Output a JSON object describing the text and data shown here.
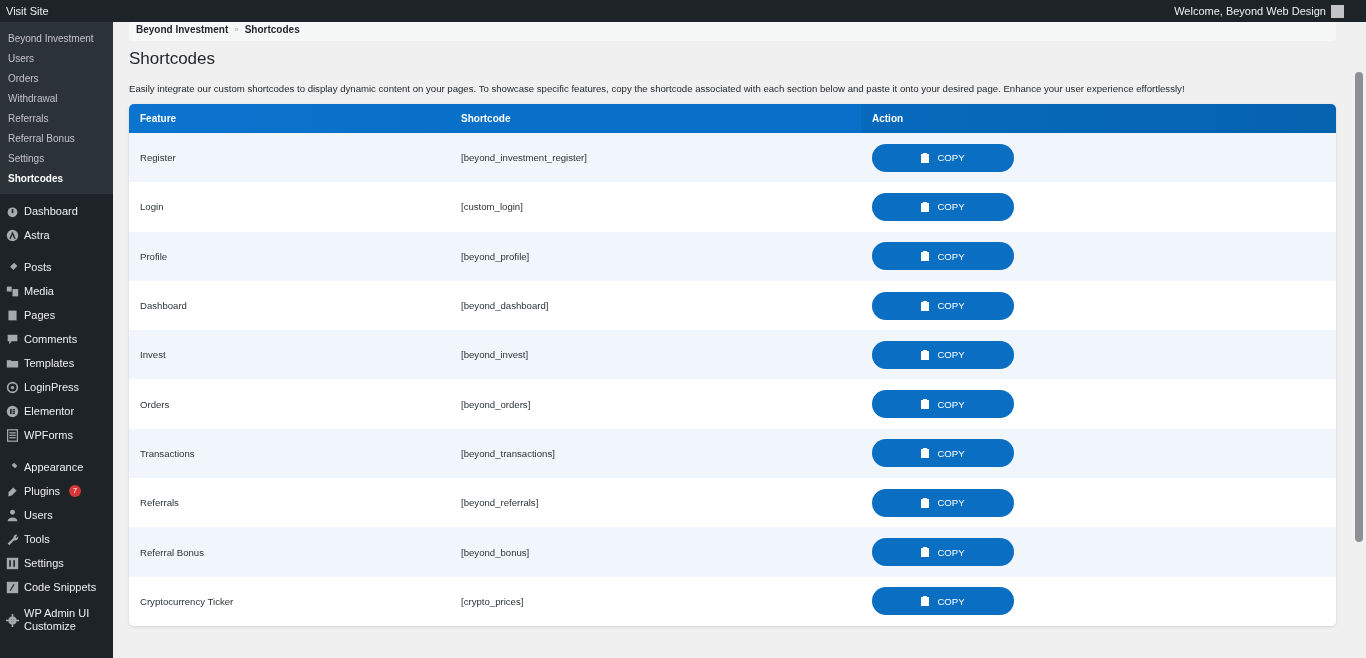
{
  "admin_bar": {
    "site_link": "Visit Site",
    "greeting": "Welcome, Beyond Web Design"
  },
  "sidebar": {
    "submenu": [
      {
        "label": "Beyond Investment",
        "selected": false
      },
      {
        "label": "Users",
        "selected": false
      },
      {
        "label": "Orders",
        "selected": false
      },
      {
        "label": "Withdrawal",
        "selected": false
      },
      {
        "label": "Referrals",
        "selected": false
      },
      {
        "label": "Referral Bonus",
        "selected": false
      },
      {
        "label": "Settings",
        "selected": false
      },
      {
        "label": "Shortcodes",
        "selected": true
      }
    ],
    "groups": [
      [
        {
          "label": "Dashboard"
        },
        {
          "label": "Astra"
        }
      ],
      [
        {
          "label": "Posts"
        },
        {
          "label": "Media"
        },
        {
          "label": "Pages"
        },
        {
          "label": "Comments"
        },
        {
          "label": "Templates"
        },
        {
          "label": "LoginPress"
        },
        {
          "label": "Elementor"
        },
        {
          "label": "WPForms"
        }
      ],
      [
        {
          "label": "Appearance"
        },
        {
          "label": "Plugins",
          "badge": "7"
        },
        {
          "label": "Users"
        },
        {
          "label": "Tools"
        },
        {
          "label": "Settings"
        },
        {
          "label": "Code Snippets"
        }
      ],
      [
        {
          "label": "WP Admin UI Customize"
        }
      ]
    ]
  },
  "breadcrumb": [
    "Beyond Investment",
    "Shortcodes"
  ],
  "breadcrumb_separator": "»",
  "title": "Shortcodes",
  "description": "Easily integrate our custom shortcodes to display dynamic content on your pages. To showcase specific features, copy the shortcode associated with each section below and paste it onto your desired page. Enhance your user experience effortlessly!",
  "table": {
    "columns": [
      "Feature",
      "Shortcode",
      "Action"
    ],
    "rows": [
      {
        "feature": "Register",
        "shortcode": "[beyond_investment_register]",
        "button": "COPY"
      },
      {
        "feature": "Login",
        "shortcode": "[custom_login]",
        "button": "COPY"
      },
      {
        "feature": "Profile",
        "shortcode": "[beyond_profile]",
        "button": "COPY"
      },
      {
        "feature": "Dashboard",
        "shortcode": "[beyond_dashboard]",
        "button": "COPY"
      },
      {
        "feature": "Invest",
        "shortcode": "[beyond_invest]",
        "button": "COPY"
      },
      {
        "feature": "Orders",
        "shortcode": "[beyond_orders]",
        "button": "COPY"
      },
      {
        "feature": "Transactions",
        "shortcode": "[beyond_transactions]",
        "button": "COPY"
      },
      {
        "feature": "Referrals",
        "shortcode": "[beyond_referrals]",
        "button": "COPY"
      },
      {
        "feature": "Referral Bonus",
        "shortcode": "[beyond_bonus]",
        "button": "COPY"
      },
      {
        "feature": "Cryptocurrency Ticker",
        "shortcode": "[crypto_prices]",
        "button": "COPY"
      }
    ]
  }
}
